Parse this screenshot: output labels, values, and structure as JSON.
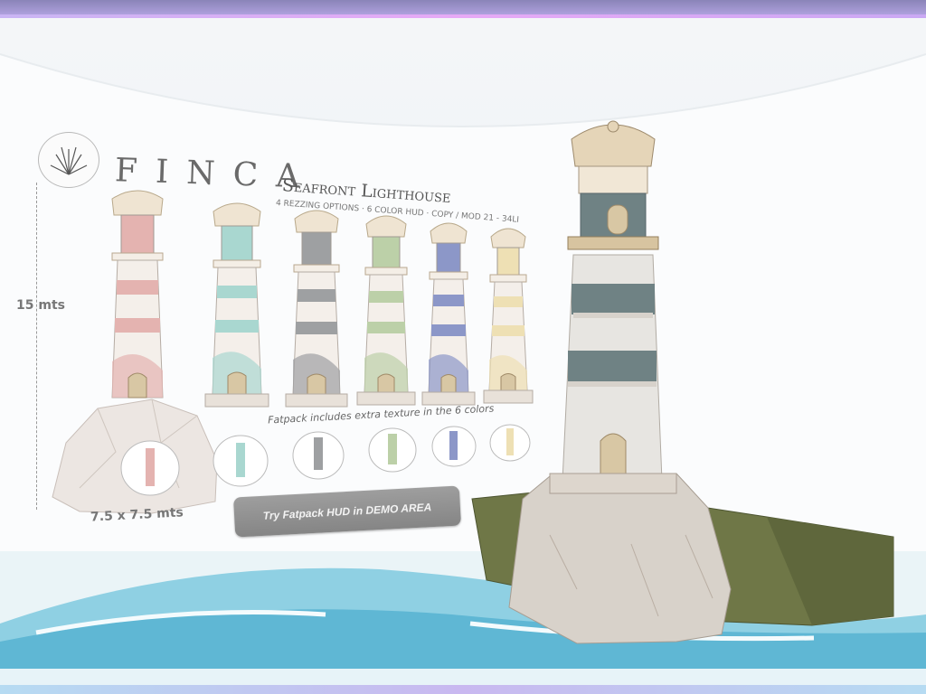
{
  "header": {
    "brand": "FINCA",
    "product": "Seafront Lighthouse",
    "subinfo": "4 REZZING OPTIONS · 6 COLOR HUD · COPY / MOD 21 - 34LI"
  },
  "labels": {
    "height": "15 mts",
    "footprint": "7.5 x 7.5 mts",
    "fatpack_note": "Fatpack includes extra texture in the 6 colors"
  },
  "demo_button": {
    "label": "Try Fatpack HUD in DEMO AREA"
  },
  "variants": [
    {
      "name": "pink",
      "color": "#e4b3b0"
    },
    {
      "name": "mint",
      "color": "#a9d7d0"
    },
    {
      "name": "gray",
      "color": "#9ea0a2"
    },
    {
      "name": "green",
      "color": "#bcd0a8"
    },
    {
      "name": "blue",
      "color": "#8c97c8"
    },
    {
      "name": "cream",
      "color": "#eee0b4"
    }
  ],
  "main_lighthouse": {
    "stripe_color": "#6f8284"
  },
  "icons": [
    "agave-logo-icon"
  ]
}
